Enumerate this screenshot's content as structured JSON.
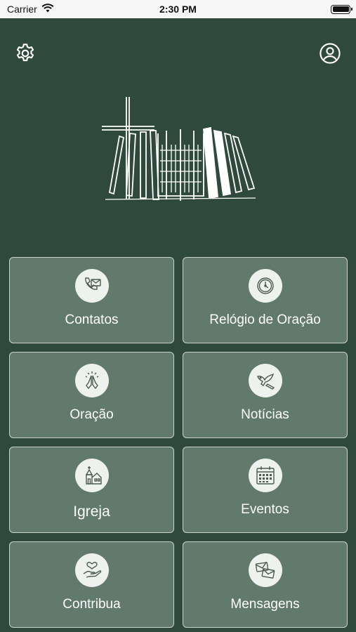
{
  "status_bar": {
    "carrier": "Carrier",
    "time": "2:30 PM"
  },
  "header": {
    "settings_icon": "gear-icon",
    "profile_icon": "user-circle-icon"
  },
  "colors": {
    "background": "#2f4a3d",
    "tile": "#617a6c",
    "tile_border": "#c9d3cc",
    "icon_bg": "#eef2ee",
    "text": "#ffffff"
  },
  "menu": {
    "items": [
      {
        "label": "Contatos",
        "icon": "phone-mail-icon"
      },
      {
        "label": "Relógio de Oração",
        "icon": "clock-icon"
      },
      {
        "label": "Oração",
        "icon": "praying-hands-icon"
      },
      {
        "label": "Notícias",
        "icon": "dove-icon"
      },
      {
        "label": "Igreja",
        "icon": "church-icon"
      },
      {
        "label": "Eventos",
        "icon": "calendar-icon"
      },
      {
        "label": "Contribua",
        "icon": "heart-hand-icon"
      },
      {
        "label": "Mensagens",
        "icon": "envelopes-icon"
      }
    ]
  }
}
